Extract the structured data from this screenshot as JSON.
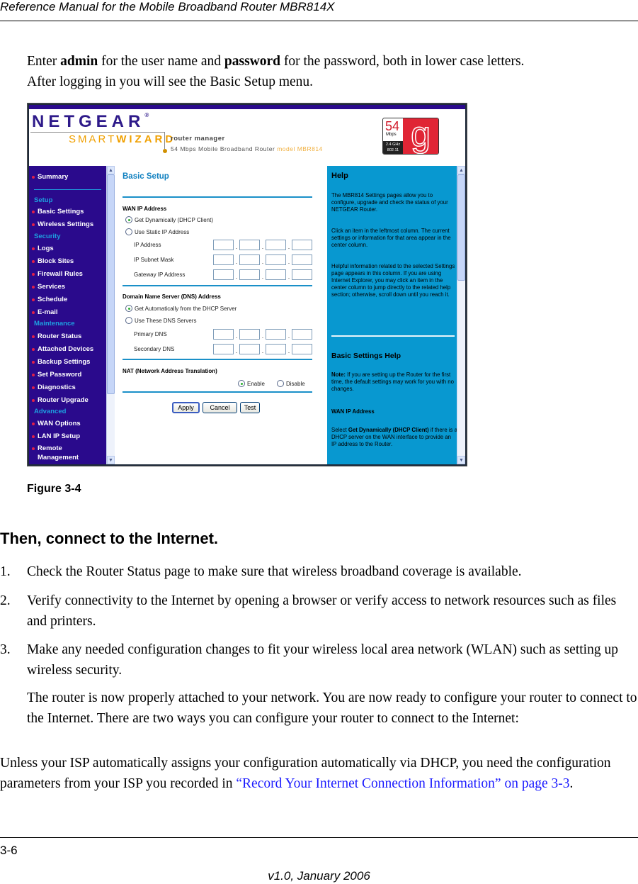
{
  "document": {
    "running_header": "Reference Manual for the Mobile Broadband Router MBR814X",
    "intro": {
      "part1": "Enter ",
      "bold1": "admin",
      "part2": " for the user name and ",
      "bold2": "password",
      "part3": " for the password, both in lower case letters.",
      "line2": "After logging in you will see the Basic Setup menu."
    },
    "figure_caption": "Figure 3-4",
    "section_heading": "Then, connect to the Internet.",
    "steps": [
      {
        "num": "1.",
        "text": "Check the Router Status page to make sure that wireless broadband coverage is available."
      },
      {
        "num": "2.",
        "text": "Verify connectivity to the Internet by opening a browser or verify access to network resources such as files and printers."
      },
      {
        "num": "3.",
        "text": "Make any needed configuration changes to fit your wireless local area network (WLAN) such as setting up wireless security."
      }
    ],
    "step_followup": "The router is now properly attached to your network. You are now ready to configure your router to connect to the Internet. There are two ways you can configure your router to connect to the Internet:",
    "closing": {
      "text": "Unless your ISP automatically assigns your configuration automatically via DHCP, you need the configuration parameters from your ISP you recorded in ",
      "link": "“Record Your Internet Connection Information” on page 3-3",
      "end": "."
    },
    "page_number": "3-6",
    "version": "v1.0, January 2006"
  },
  "router_ui": {
    "brand": {
      "netgear": "NETGEAR",
      "smart": "SMART",
      "wizard": "WIZARD",
      "router_manager": "router manager",
      "subtitle": "54 Mbps Mobile Broadband Router ",
      "model": "model MBR814",
      "badge_speed": "54",
      "badge_unit": "Mbps",
      "badge_freq": "2.4 GHz",
      "badge_std": "802.11",
      "badge_letter": "g"
    },
    "nav": {
      "summary": "Summary",
      "sections": [
        {
          "title": "Setup",
          "items": [
            "Basic Settings",
            "Wireless Settings"
          ]
        },
        {
          "title": "Security",
          "items": [
            "Logs",
            "Block Sites",
            "Firewall Rules",
            "Services",
            "Schedule",
            "E-mail"
          ]
        },
        {
          "title": "Maintenance",
          "items": [
            "Router Status",
            "Attached Devices",
            "Backup Settings",
            "Set Password",
            "Diagnostics",
            "Router Upgrade"
          ]
        },
        {
          "title": "Advanced",
          "items": [
            "WAN Options",
            "LAN IP Setup",
            "Remote Management"
          ]
        }
      ]
    },
    "form": {
      "title": "Basic Setup",
      "wan_heading": "WAN IP Address",
      "wan_options": [
        "Get Dynamically (DHCP Client)",
        "Use Static IP Address"
      ],
      "wan_selected": 0,
      "wan_fields": [
        "IP Address",
        "IP Subnet Mask",
        "Gateway IP Address"
      ],
      "dns_heading": "Domain Name Server (DNS) Address",
      "dns_options": [
        "Get Automatically from the DHCP Server",
        "Use These DNS Servers"
      ],
      "dns_selected": 0,
      "dns_fields": [
        "Primary DNS",
        "Secondary DNS"
      ],
      "nat_heading": "NAT (Network Address Translation)",
      "nat_options": [
        "Enable",
        "Disable"
      ],
      "nat_selected": 0,
      "buttons": {
        "apply": "Apply",
        "cancel": "Cancel",
        "test": "Test"
      }
    },
    "help": {
      "title": "Help",
      "p1": "The MBR814 Settings pages allow you to configure, upgrade and check the status of your NETGEAR Router.",
      "p2": "Click an item in the leftmost column. The current settings or information for that area appear in the center column.",
      "p3": "Helpful information related to the selected Settings page appears in this column. If you are using Internet Explorer, you may click an item in the center column to jump directly to the related help section; otherwise, scroll down until you reach it.",
      "h2": "Basic Settings Help",
      "note_label": "Note:",
      "note": " If you are setting up the Router for the first time, the default settings may work for you with no changes.",
      "wan_heading": "WAN IP Address",
      "wan_pre": "Select ",
      "wan_bold": "Get Dynamically (DHCP Client)",
      "wan_post": " if there is a DHCP server on the WAN interface to provide an IP address to the Router."
    }
  }
}
